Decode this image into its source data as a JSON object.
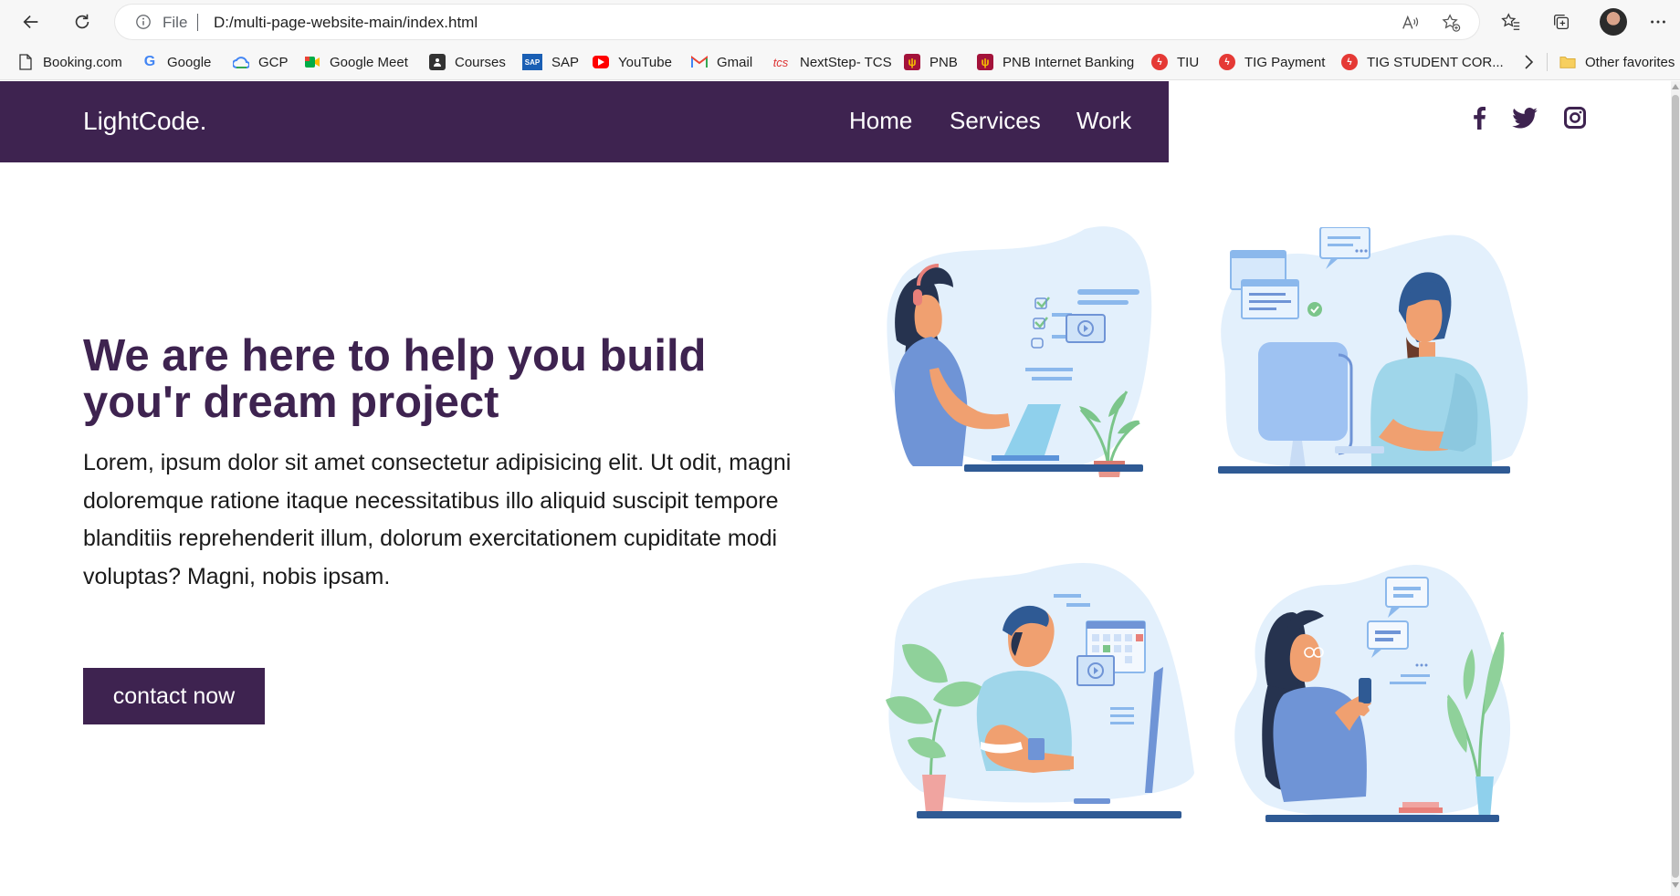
{
  "browser": {
    "url_scheme": "File",
    "url": "D:/multi-page-website-main/index.html",
    "bookmarks": [
      {
        "label": "Booking.com",
        "icon": "document-icon"
      },
      {
        "label": "Google",
        "icon": "google-icon"
      },
      {
        "label": "GCP",
        "icon": "gcp-icon"
      },
      {
        "label": "Google Meet",
        "icon": "meet-icon"
      },
      {
        "label": "Courses",
        "icon": "courses-icon"
      },
      {
        "label": "SAP",
        "icon": "sap-icon"
      },
      {
        "label": "YouTube",
        "icon": "youtube-icon"
      },
      {
        "label": "Gmail",
        "icon": "gmail-icon"
      },
      {
        "label": "NextStep- TCS",
        "icon": "tcs-icon"
      },
      {
        "label": "PNB",
        "icon": "pnb-icon"
      },
      {
        "label": "PNB Internet Banking",
        "icon": "pnb-icon"
      },
      {
        "label": "TIU",
        "icon": "tiu-icon"
      },
      {
        "label": "TIG Payment",
        "icon": "tig-icon"
      },
      {
        "label": "TIG STUDENT COR...",
        "icon": "tig-icon"
      }
    ],
    "other_favorites": "Other favorites"
  },
  "site": {
    "logo": "LightCode.",
    "nav": [
      "Home",
      "Services",
      "Work"
    ],
    "social": [
      "facebook-icon",
      "twitter-icon",
      "instagram-icon"
    ],
    "hero": {
      "title": "We are here to help you build you'r dream project",
      "text": "Lorem, ipsum dolor sit amet consectetur adipisicing elit. Ut odit, magni doloremque ratione itaque necessitatibus illo aliquid suscipit tempore blanditiis reprehenderit illum, dolorum exercitationem cupiditate modi voluptas? Magni, nobis ipsam.",
      "cta": "contact now"
    }
  },
  "colors": {
    "brand": "#3e2350",
    "blob": "#e3f0fc",
    "skin": "#f0a070",
    "shirt_blue": "#6f94d6",
    "shirt_light": "#9fd6ea",
    "hair": "#26334f",
    "desk": "#2f5a94",
    "plant": "#7bc58a"
  }
}
